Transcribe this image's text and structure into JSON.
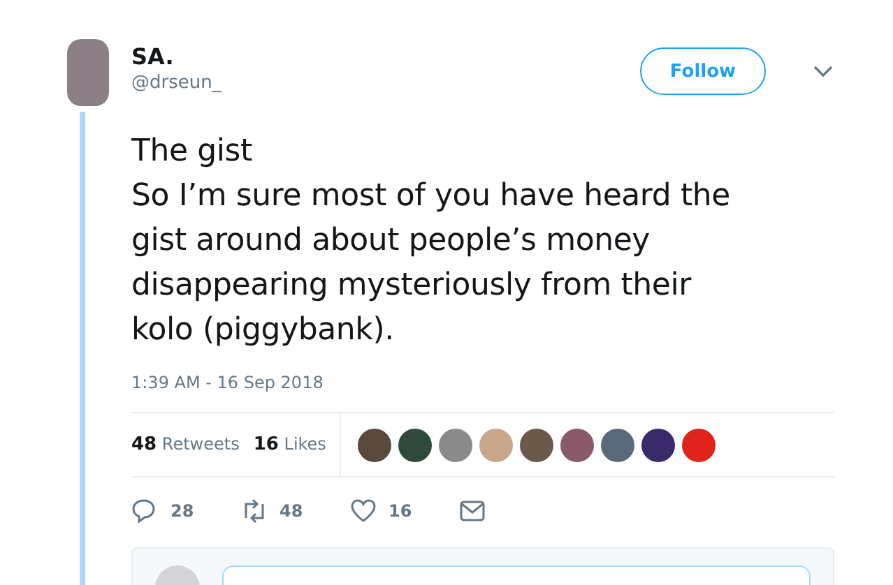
{
  "author": {
    "name": "SA.",
    "handle": "@drseun_"
  },
  "follow_button": "Follow",
  "tweet_text": "The gist\nSo I’m sure most of you have heard the\ngist around about people’s money\ndisappearing mysteriously from their\nkolo (piggybank).",
  "timestamp": "1:39 AM - 16 Sep 2018",
  "stats": [
    {
      "count": "48",
      "label": "Retweets"
    },
    {
      "count": "16",
      "label": "Likes"
    }
  ],
  "liker_avatars": [
    {
      "color": "#5a4a3e"
    },
    {
      "color": "#2f4a3a"
    },
    {
      "color": "#8a8a8a"
    },
    {
      "color": "#c9a58a"
    },
    {
      "color": "#6b5a4a"
    },
    {
      "color": "#8a5a6a"
    },
    {
      "color": "#5a6a7a"
    },
    {
      "color": "#3a2a6a"
    },
    {
      "color": "#e0241b"
    }
  ],
  "actions": [
    {
      "kind": "reply",
      "count": "28"
    },
    {
      "kind": "retweet",
      "count": "48"
    },
    {
      "kind": "like",
      "count": "16"
    },
    {
      "kind": "message"
    }
  ]
}
